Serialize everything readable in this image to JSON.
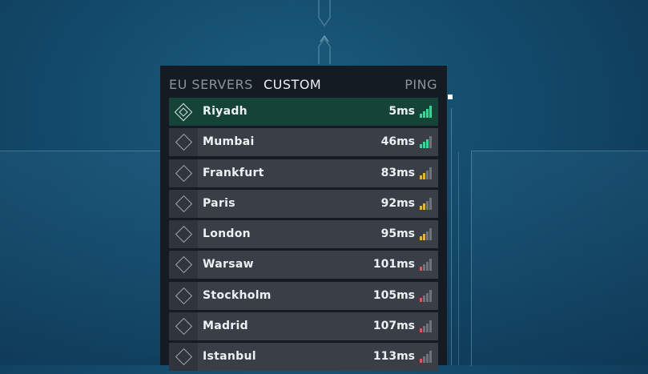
{
  "header": {
    "tab_eu": "EU SERVERS",
    "tab_custom": "CUSTOM",
    "ping": "PING"
  },
  "servers": [
    {
      "name": "Riyadh",
      "ping": "5ms",
      "signal": 4,
      "color": "#3fd39a",
      "selected": true
    },
    {
      "name": "Mumbai",
      "ping": "46ms",
      "signal": 3,
      "color": "#3fd39a"
    },
    {
      "name": "Frankfurt",
      "ping": "83ms",
      "signal": 2,
      "color": "#e3b33b"
    },
    {
      "name": "Paris",
      "ping": "92ms",
      "signal": 2,
      "color": "#e3b33b"
    },
    {
      "name": "London",
      "ping": "95ms",
      "signal": 2,
      "color": "#e3b33b"
    },
    {
      "name": "Warsaw",
      "ping": "101ms",
      "signal": 1,
      "color": "#e0565b"
    },
    {
      "name": "Stockholm",
      "ping": "105ms",
      "signal": 1,
      "color": "#e0565b"
    },
    {
      "name": "Madrid",
      "ping": "107ms",
      "signal": 1,
      "color": "#e0565b"
    },
    {
      "name": "Istanbul",
      "ping": "113ms",
      "signal": 1,
      "color": "#e0565b"
    }
  ],
  "colors": {
    "inactive_bar": "#6e747b"
  }
}
